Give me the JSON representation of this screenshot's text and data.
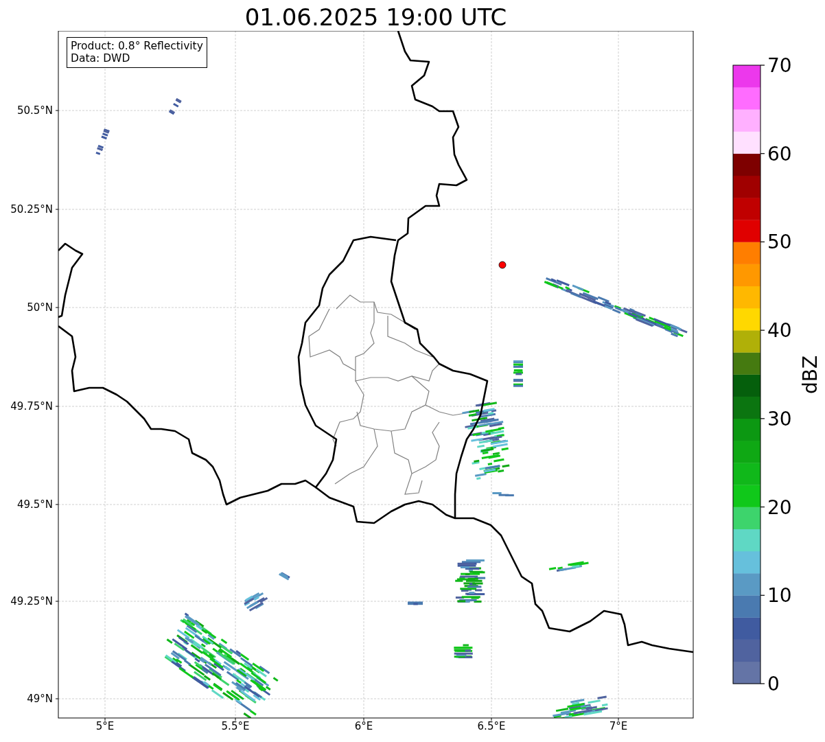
{
  "title": "01.06.2025 19:00 UTC",
  "info_box": {
    "lines": [
      "Product: 0.8° Reflectivity",
      "Data: DWD"
    ]
  },
  "map": {
    "x_ticks": [
      "5°E",
      "5.5°E",
      "6°E",
      "6.5°E",
      "7°E"
    ],
    "y_ticks": [
      "50.5°N",
      "50.25°N",
      "50°N",
      "49.75°N",
      "49.5°N",
      "49.25°N",
      "49°N"
    ]
  },
  "colorbar": {
    "label": "dBZ",
    "ticks": [
      "70",
      "60",
      "50",
      "40",
      "30",
      "20",
      "10",
      "0"
    ],
    "bands": [
      {
        "color": "#6474a6"
      },
      {
        "color": "#50639f"
      },
      {
        "color": "#405ba0"
      },
      {
        "color": "#4a7ab0"
      },
      {
        "color": "#5a9ac4"
      },
      {
        "color": "#66c0dc"
      },
      {
        "color": "#5fd8c4"
      },
      {
        "color": "#3dd46c"
      },
      {
        "color": "#10c81a"
      },
      {
        "color": "#10b81a"
      },
      {
        "color": "#0fa814"
      },
      {
        "color": "#0c9812"
      },
      {
        "color": "#0b7510"
      },
      {
        "color": "#055f0c"
      },
      {
        "color": "#457a10"
      },
      {
        "color": "#b0b008"
      },
      {
        "color": "#ffd800"
      },
      {
        "color": "#ffb800"
      },
      {
        "color": "#ff9800"
      },
      {
        "color": "#ff7e00"
      },
      {
        "color": "#e00000"
      },
      {
        "color": "#c00000"
      },
      {
        "color": "#a00000"
      },
      {
        "color": "#7e0000"
      },
      {
        "color": "#ffe0ff"
      },
      {
        "color": "#ffb0ff"
      },
      {
        "color": "#ff6cff"
      },
      {
        "color": "#ec38ec"
      }
    ]
  }
}
